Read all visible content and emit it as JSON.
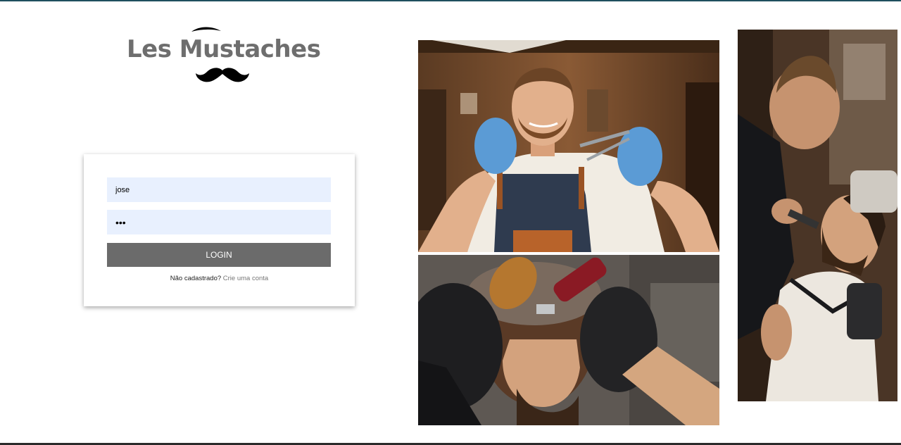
{
  "brand": {
    "name": "Les Mustaches",
    "brow_icon": "eyebrow-icon",
    "mustache_icon": "mustache-icon",
    "text_color": "#6e6e6e"
  },
  "login": {
    "username_value": "jose",
    "password_value": "•••",
    "button_label": "LOGIN",
    "signup_prompt": "Não cadastrado?",
    "signup_link": "Crie uma conta",
    "field_bg": "#e8f0fe",
    "button_bg": "#6b6b6b"
  },
  "gallery": {
    "images": [
      "barber-with-scissors-photo",
      "haircut-with-clippers-photo",
      "beard-trim-photo"
    ]
  }
}
